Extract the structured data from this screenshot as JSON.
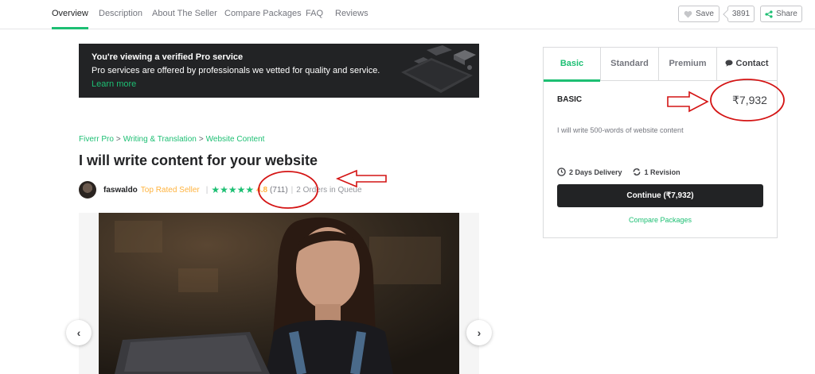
{
  "nav": {
    "tabs": [
      {
        "label": "Overview"
      },
      {
        "label": "Description"
      },
      {
        "label": "About The Seller"
      },
      {
        "label": "Compare Packages"
      },
      {
        "label": "FAQ"
      },
      {
        "label": "Reviews"
      }
    ],
    "save_label": "Save",
    "save_count": "3891",
    "share_label": "Share"
  },
  "banner": {
    "title": "You're viewing a verified Pro service",
    "text": "Pro services are offered by professionals we vetted for quality and service.",
    "link": "Learn more"
  },
  "breadcrumb": {
    "items": [
      "Fiverr Pro",
      "Writing & Translation",
      "Website Content"
    ],
    "separator": ">"
  },
  "gig": {
    "title": "I will write content for your website",
    "seller_name": "faswaldo",
    "seller_level": "Top Rated Seller",
    "stars": "★★★★★",
    "rating": "4.8",
    "review_count": "(711)",
    "orders_in_queue": "2 Orders in Queue"
  },
  "gallery": {
    "prev_icon": "‹",
    "next_icon": "›"
  },
  "package": {
    "tabs": [
      "Basic",
      "Standard",
      "Premium",
      "Contact"
    ],
    "name": "BASIC",
    "price": "₹7,932",
    "description": "I will write 500-words of website content",
    "delivery": "2 Days Delivery",
    "revisions": "1 Revision",
    "continue_label": "Continue (₹7,932)",
    "compare_label": "Compare Packages"
  },
  "colors": {
    "accent": "#1dbf73",
    "rating": "#ffb33e",
    "annotation": "#d41414"
  }
}
